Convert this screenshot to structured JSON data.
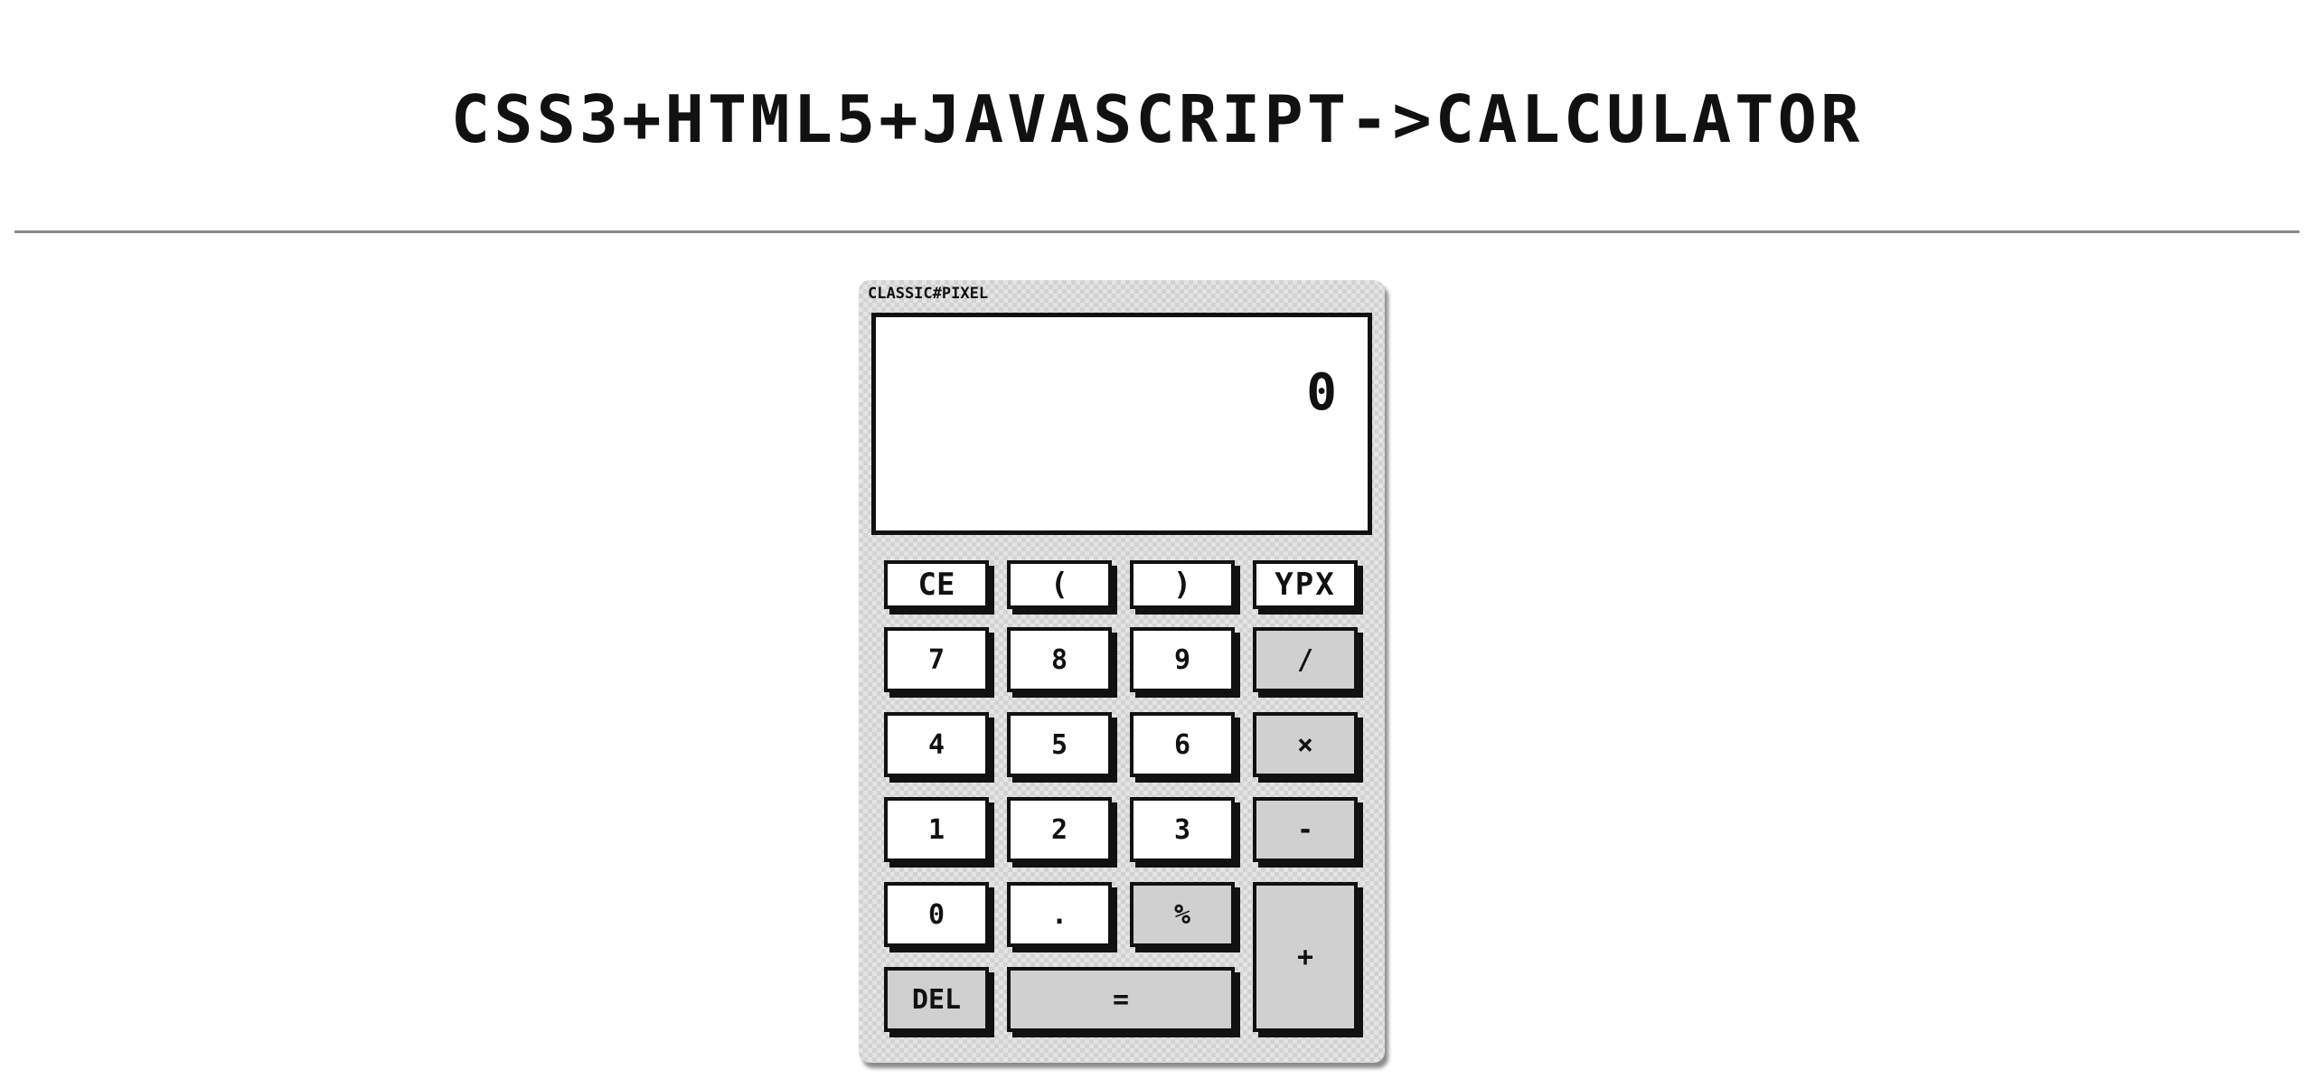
{
  "page": {
    "title": "CSS3+HTML5+JAVASCRIPT->CALCULATOR"
  },
  "calculator": {
    "brand": "CLASSIC#PIXEL",
    "display_value": "0",
    "colors": {
      "key_face": "#ffffff",
      "operator_face": "#d0d0d0",
      "outline": "#111111",
      "body": "#e4e4e4"
    },
    "keys": {
      "ce": "CE",
      "open_paren": "(",
      "close_paren": ")",
      "ypx": "YPX",
      "seven": "7",
      "eight": "8",
      "nine": "9",
      "divide": "/",
      "four": "4",
      "five": "5",
      "six": "6",
      "multiply": "×",
      "one": "1",
      "two": "2",
      "three": "3",
      "minus": "-",
      "zero": "0",
      "dot": ".",
      "percent": "%",
      "plus": "+",
      "del": "DEL",
      "equals": "="
    }
  }
}
